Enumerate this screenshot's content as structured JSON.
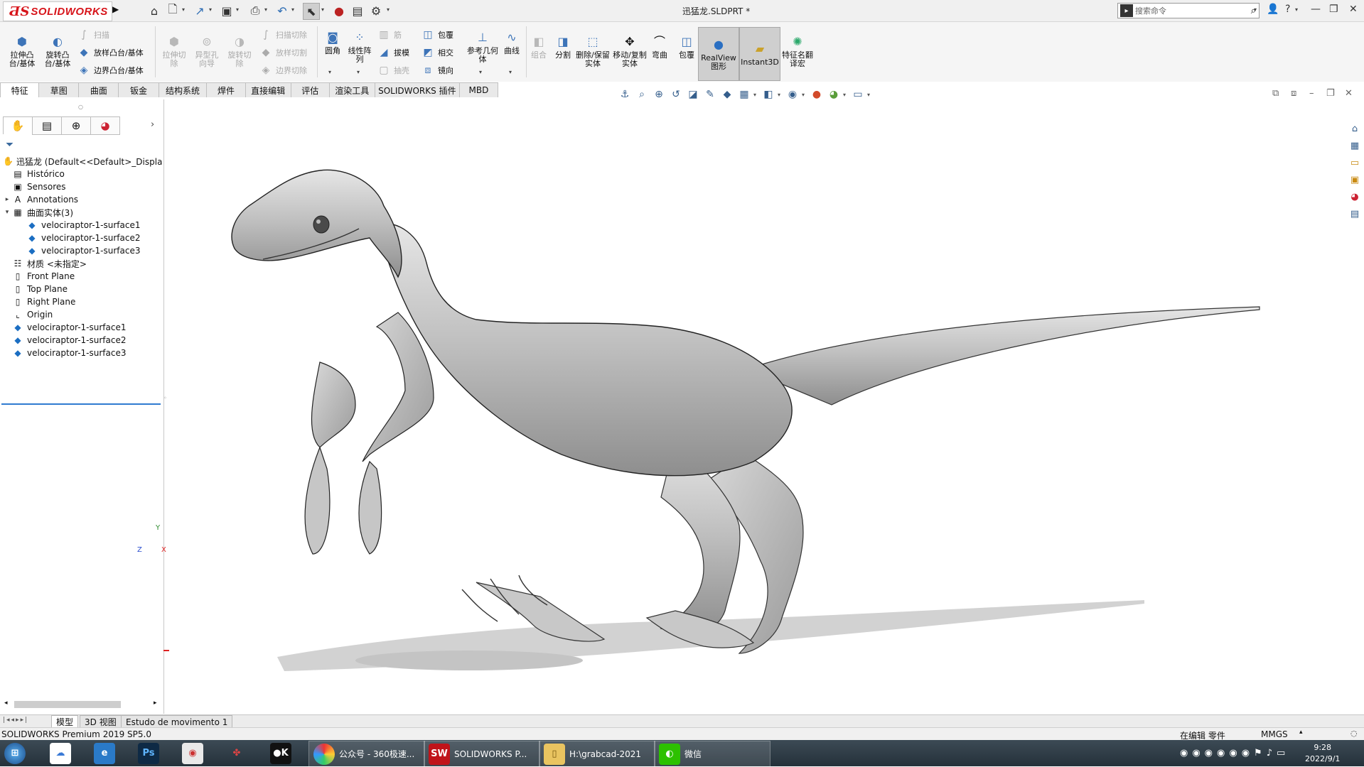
{
  "title_bar": {
    "brand": "SOLIDWORKS",
    "doc_title": "迅猛龙.SLDPRT *",
    "search_placeholder": "搜索命令",
    "help_label": "?"
  },
  "command_manager": {
    "tools": [
      {
        "id": "extrude-boss",
        "label": "拉伸凸台/基体",
        "enabled": true
      },
      {
        "id": "revolve-boss",
        "label": "旋转凸台/基体",
        "enabled": true
      },
      {
        "id": "sweep",
        "label": "扫描",
        "enabled": false
      },
      {
        "id": "loft-boss",
        "label": "放样凸台/基体",
        "enabled": true
      },
      {
        "id": "boundary-boss",
        "label": "边界凸台/基体",
        "enabled": true
      },
      {
        "id": "extrude-cut",
        "label": "拉伸切除",
        "enabled": false
      },
      {
        "id": "hole-wizard",
        "label": "异型孔向导",
        "enabled": false
      },
      {
        "id": "revolve-cut",
        "label": "旋转切除",
        "enabled": false
      },
      {
        "id": "swept-cut",
        "label": "扫描切除",
        "enabled": false
      },
      {
        "id": "lofted-cut",
        "label": "放样切割",
        "enabled": false
      },
      {
        "id": "boundary-cut",
        "label": "边界切除",
        "enabled": false
      },
      {
        "id": "fillet",
        "label": "圆角",
        "enabled": true
      },
      {
        "id": "linear-pattern",
        "label": "线性阵列",
        "enabled": true
      },
      {
        "id": "rib",
        "label": "筋",
        "enabled": false
      },
      {
        "id": "draft",
        "label": "拔模",
        "enabled": true
      },
      {
        "id": "shell",
        "label": "抽壳",
        "enabled": false
      },
      {
        "id": "wrap",
        "label": "包覆",
        "enabled": true
      },
      {
        "id": "intersect",
        "label": "相交",
        "enabled": true
      },
      {
        "id": "mirror",
        "label": "镜向",
        "enabled": true
      },
      {
        "id": "ref-geometry",
        "label": "参考几何体",
        "enabled": true
      },
      {
        "id": "curves",
        "label": "曲线",
        "enabled": true
      },
      {
        "id": "combine",
        "label": "组合",
        "enabled": false
      },
      {
        "id": "split",
        "label": "分割",
        "enabled": true
      },
      {
        "id": "delete-body",
        "label": "删除/保留实体",
        "enabled": true
      },
      {
        "id": "move-copy",
        "label": "移动/复制实体",
        "enabled": true
      },
      {
        "id": "flex",
        "label": "弯曲",
        "enabled": true
      },
      {
        "id": "wrap2",
        "label": "包覆",
        "enabled": true
      },
      {
        "id": "realview",
        "label": "RealView 图形",
        "enabled": true
      },
      {
        "id": "instant3d",
        "label": "Instant3D",
        "enabled": true
      },
      {
        "id": "feature-translate",
        "label": "特征名翻译宏",
        "enabled": true
      }
    ]
  },
  "tabs": [
    "特征",
    "草图",
    "曲面",
    "钣金",
    "结构系统",
    "焊件",
    "直接编辑",
    "评估",
    "渲染工具",
    "SOLIDWORKS 插件",
    "MBD"
  ],
  "active_tab": "特征",
  "feature_tree": {
    "root": "迅猛龙  (Default<<Default>_Displa",
    "items": [
      {
        "label": "Histórico",
        "icon": "history-icon",
        "expand": ""
      },
      {
        "label": "Sensores",
        "icon": "sensor-icon",
        "expand": ""
      },
      {
        "label": "Annotations",
        "icon": "annotation-icon",
        "expand": "▸"
      },
      {
        "label": "曲面实体(3)",
        "icon": "surface-bodies-icon",
        "expand": "▾"
      },
      {
        "label": "velociraptor-1-surface1",
        "icon": "surface-icon",
        "expand": "",
        "indent": true
      },
      {
        "label": "velociraptor-1-surface2",
        "icon": "surface-icon",
        "expand": "",
        "indent": true
      },
      {
        "label": "velociraptor-1-surface3",
        "icon": "surface-icon",
        "expand": "",
        "indent": true
      },
      {
        "label": "材质 <未指定>",
        "icon": "material-icon",
        "expand": ""
      },
      {
        "label": "Front Plane",
        "icon": "plane-icon",
        "expand": ""
      },
      {
        "label": "Top Plane",
        "icon": "plane-icon",
        "expand": ""
      },
      {
        "label": "Right Plane",
        "icon": "plane-icon",
        "expand": ""
      },
      {
        "label": "Origin",
        "icon": "origin-icon",
        "expand": ""
      },
      {
        "label": "velociraptor-1-surface1",
        "icon": "surface-feature-icon",
        "expand": ""
      },
      {
        "label": "velociraptor-1-surface2",
        "icon": "surface-feature-icon",
        "expand": ""
      },
      {
        "label": "velociraptor-1-surface3",
        "icon": "surface-feature-icon",
        "expand": ""
      }
    ]
  },
  "bottom_tabs": [
    "模型",
    "3D 视图",
    "Estudo de movimento 1"
  ],
  "status": {
    "product": "SOLIDWORKS Premium 2019 SP5.0",
    "editing": "在编辑 零件",
    "units": "MMGS"
  },
  "taskbar": {
    "items": [
      {
        "label": "公众号 - 360极速...",
        "icon": "360-browser-icon"
      },
      {
        "label": "SOLIDWORKS P...",
        "icon": "solidworks-icon"
      },
      {
        "label": "H:\\grabcad-2021",
        "icon": "folder-icon"
      },
      {
        "label": "微信",
        "icon": "wechat-icon"
      }
    ],
    "time": "9:28",
    "date": "2022/9/1"
  },
  "triad": {
    "x": "X",
    "y": "Y",
    "z": "Z"
  },
  "colors": {
    "brand": "#d7141a",
    "selection": "#2f7bd0",
    "taskbar": "#2c3944"
  }
}
